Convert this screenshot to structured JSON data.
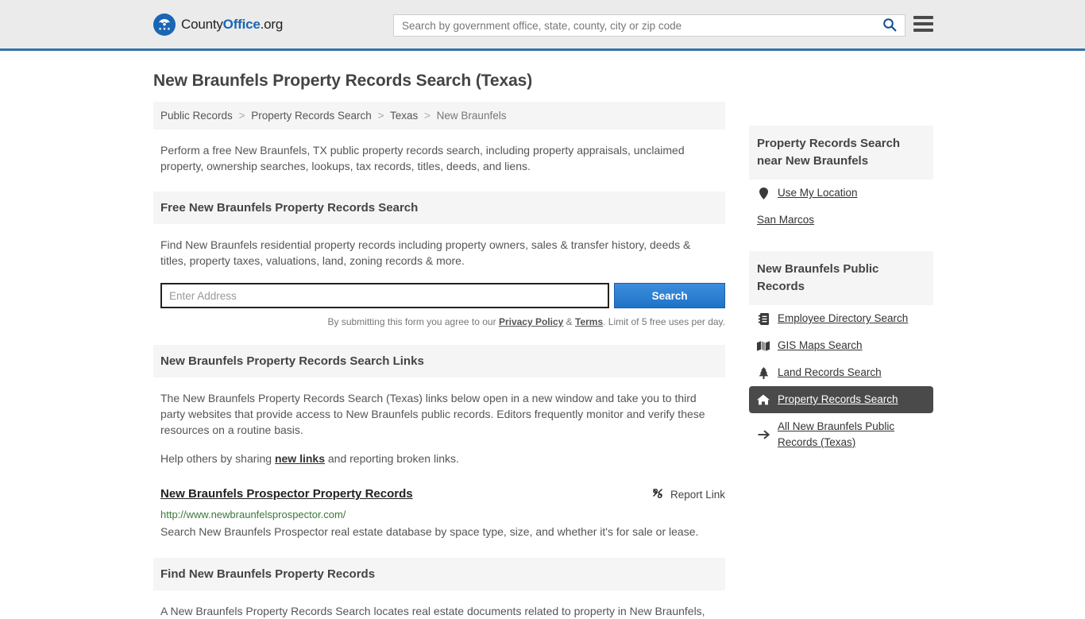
{
  "header": {
    "logo": {
      "part1": "County",
      "part2": "Office",
      "part3": ".org",
      "emblem_icon": "eagle-stars-emblem"
    },
    "search": {
      "placeholder": "Search by government office, state, county, city or zip code",
      "value": "",
      "icon": "search-icon"
    },
    "menu_icon": "hamburger-menu-icon",
    "accent_color": "#3573a8",
    "background_color": "#ebebeb"
  },
  "page_title": "New Braunfels Property Records Search (Texas)",
  "breadcrumb": {
    "separator": ">",
    "items": [
      {
        "label": "Public Records",
        "current": false
      },
      {
        "label": "Property Records Search",
        "current": false
      },
      {
        "label": "Texas",
        "current": false
      },
      {
        "label": "New Braunfels",
        "current": true
      }
    ]
  },
  "intro_text": "Perform a free New Braunfels, TX public property records search, including property appraisals, unclaimed property, ownership searches, lookups, tax records, titles, deeds, and liens.",
  "free_search": {
    "heading": "Free New Braunfels Property Records Search",
    "description": "Find New Braunfels residential property records including property owners, sales & transfer history, deeds & titles, property taxes, valuations, land, zoning records & more.",
    "address_placeholder": "Enter Address",
    "address_value": "",
    "submit_label": "Search",
    "submit_color": "#1f73c7",
    "disclaimer_prefix": "By submitting this form you agree to our ",
    "privacy_label": "Privacy Policy",
    "disclaimer_amp": " & ",
    "terms_label": "Terms",
    "disclaimer_suffix": ". Limit of 5 free uses per day."
  },
  "links_section": {
    "heading": "New Braunfels Property Records Search Links",
    "paragraph": "The New Braunfels Property Records Search (Texas) links below open in a new window and take you to third party websites that provide access to New Braunfels public records. Editors frequently monitor and verify these resources on a routine basis.",
    "help_prefix": "Help others by sharing ",
    "help_link": "new links",
    "help_suffix": " and reporting broken links.",
    "results": [
      {
        "title": "New Braunfels Prospector Property Records",
        "url": "http://www.newbraunfelsprospector.com/",
        "description": "Search New Braunfels Prospector real estate database by space type, size, and whether it's for sale or lease.",
        "report_label": "Report Link",
        "report_icon": "broken-link-icon",
        "url_color": "#3a7a3a"
      }
    ]
  },
  "find_section": {
    "heading": "Find New Braunfels Property Records",
    "paragraph": "A New Braunfels Property Records Search locates real estate documents related to property in New Braunfels,"
  },
  "sidebar": {
    "nearby": {
      "heading": "Property Records Search near New Braunfels",
      "items": [
        {
          "label": "Use My Location",
          "icon": "map-pin-icon",
          "active": false
        },
        {
          "label": "San Marcos",
          "icon": "none",
          "active": false
        }
      ]
    },
    "public_records": {
      "heading": "New Braunfels Public Records",
      "active_color": "#4a4a4a",
      "items": [
        {
          "label": "Employee Directory Search",
          "icon": "address-book-icon",
          "active": false
        },
        {
          "label": "GIS Maps Search",
          "icon": "map-icon",
          "active": false
        },
        {
          "label": "Land Records Search",
          "icon": "tree-icon",
          "active": false
        },
        {
          "label": "Property Records Search",
          "icon": "home-icon",
          "active": true
        },
        {
          "label": "All New Braunfels Public Records (Texas)",
          "icon": "arrow-right-icon",
          "active": false
        }
      ]
    }
  }
}
